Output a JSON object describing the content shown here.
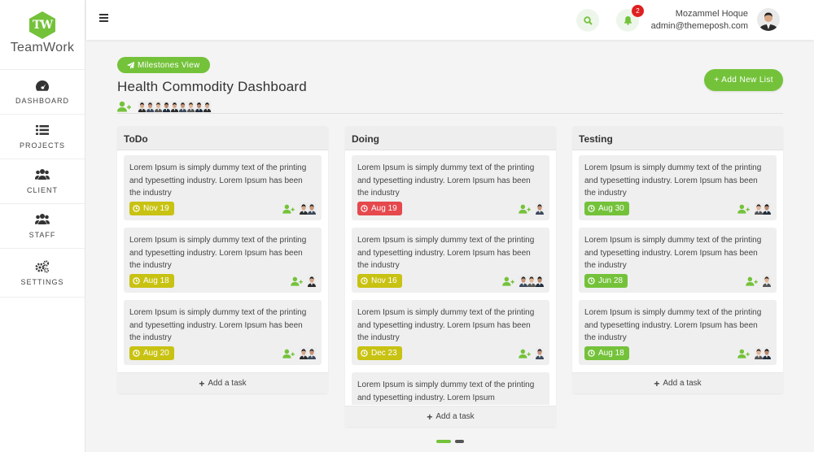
{
  "brand": {
    "logo_letters": "TW",
    "name": "TeamWork",
    "color": "#74c23a"
  },
  "sidebar": {
    "items": [
      {
        "label": "DASHBOARD",
        "icon": "dashboard-gauge-icon"
      },
      {
        "label": "PROJECTS",
        "icon": "list-icon"
      },
      {
        "label": "CLIENT",
        "icon": "users-icon"
      },
      {
        "label": "STAFF",
        "icon": "users-icon"
      },
      {
        "label": "SETTINGS",
        "icon": "gears-icon"
      }
    ]
  },
  "header": {
    "menu_icon": "hamburger-icon",
    "search_icon": "search-icon",
    "bell_icon": "bell-icon",
    "notification_count": "2",
    "user_name": "Mozammel Hoque",
    "user_email": "admin@themeposh.com"
  },
  "main": {
    "milestones_label": "Milestones View",
    "title": "Health Commodity Dashboard",
    "add_list_label": "+ Add New List",
    "member_count": 9
  },
  "board": {
    "add_task_label": "Add a task",
    "columns": [
      {
        "title": "ToDo",
        "cards": [
          {
            "text": "Lorem Ipsum is simply dummy text of the printing and typesetting industry. Lorem Ipsum has been the industry",
            "date": "Nov 19",
            "status": "yellow",
            "people": 2
          },
          {
            "text": "Lorem Ipsum is simply dummy text of the printing and typesetting industry. Lorem Ipsum has been the industry",
            "date": "Aug 18",
            "status": "yellow",
            "people": 1
          },
          {
            "text": "Lorem Ipsum is simply dummy text of the printing and typesetting industry. Lorem Ipsum has been the industry",
            "date": "Aug 20",
            "status": "yellow",
            "people": 2
          }
        ]
      },
      {
        "title": "Doing",
        "cards": [
          {
            "text": "Lorem Ipsum is simply dummy text of the printing and typesetting industry. Lorem Ipsum has been the industry",
            "date": "Aug 19",
            "status": "red",
            "people": 1
          },
          {
            "text": "Lorem Ipsum is simply dummy text of the printing and typesetting industry. Lorem Ipsum has been the industry",
            "date": "Nov 16",
            "status": "yellow",
            "people": 3
          },
          {
            "text": "Lorem Ipsum is simply dummy text of the printing and typesetting industry. Lorem Ipsum has been the industry",
            "date": "Dec 23",
            "status": "yellow",
            "people": 1
          },
          {
            "text": "Lorem Ipsum is simply dummy text of the printing and typesetting industry. Lorem Ipsum",
            "date": "",
            "status": "",
            "people": 0
          }
        ]
      },
      {
        "title": "Testing",
        "cards": [
          {
            "text": "Lorem Ipsum is simply dummy text of the printing and typesetting industry. Lorem Ipsum has been the industry",
            "date": "Aug 30",
            "status": "green",
            "people": 2
          },
          {
            "text": "Lorem Ipsum is simply dummy text of the printing and typesetting industry. Lorem Ipsum has been the industry",
            "date": "Jun 28",
            "status": "green",
            "people": 1
          },
          {
            "text": "Lorem Ipsum is simply dummy text of the printing and typesetting industry. Lorem Ipsum has been the industry",
            "date": "Aug 18",
            "status": "green",
            "people": 2
          }
        ]
      }
    ]
  },
  "colors": {
    "yellow": "#c8c213",
    "red": "#e5484d",
    "green": "#74c23a",
    "accent": "#74c23a"
  }
}
